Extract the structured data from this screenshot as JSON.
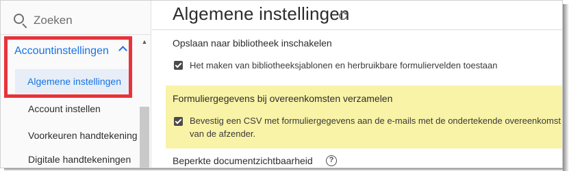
{
  "sidebar": {
    "search_placeholder": "Zoeken",
    "section_label": "Accountinstellingen",
    "active_item_label": "Algemene instellingen",
    "items": [
      {
        "label": "Account instellen"
      },
      {
        "label": "Voorkeuren handtekening"
      },
      {
        "label": "Digitale handtekeningen"
      }
    ]
  },
  "main": {
    "title": "Algemene instellingen",
    "sections": [
      {
        "title": "Opslaan naar bibliotheek inschakelen",
        "checkbox_label": "Het maken van bibliotheeksjablonen en herbruikbare formuliervelden toestaan",
        "checked": true
      },
      {
        "title": "Formuliergegevens bij overeenkomsten verzamelen",
        "checkbox_label_line1": "Bevestig een CSV met formuliergegevens aan de e-mails met de ondertekende overeenkomst",
        "checkbox_label_line2": "van de afzender.",
        "checked": true,
        "highlighted": true
      },
      {
        "title": "Beperkte documentzichtbaarheid"
      }
    ]
  },
  "colors": {
    "accent": "#1473e6",
    "highlight_border": "#e8333a",
    "highlight_background": "#f9f3a7",
    "active_item_background": "#e8eef7"
  },
  "icons": {
    "search": "search-icon",
    "chevron": "chevron-up-icon",
    "refresh": "refresh-icon",
    "help": "help-icon",
    "checkbox": "checkbox-checked-icon"
  }
}
